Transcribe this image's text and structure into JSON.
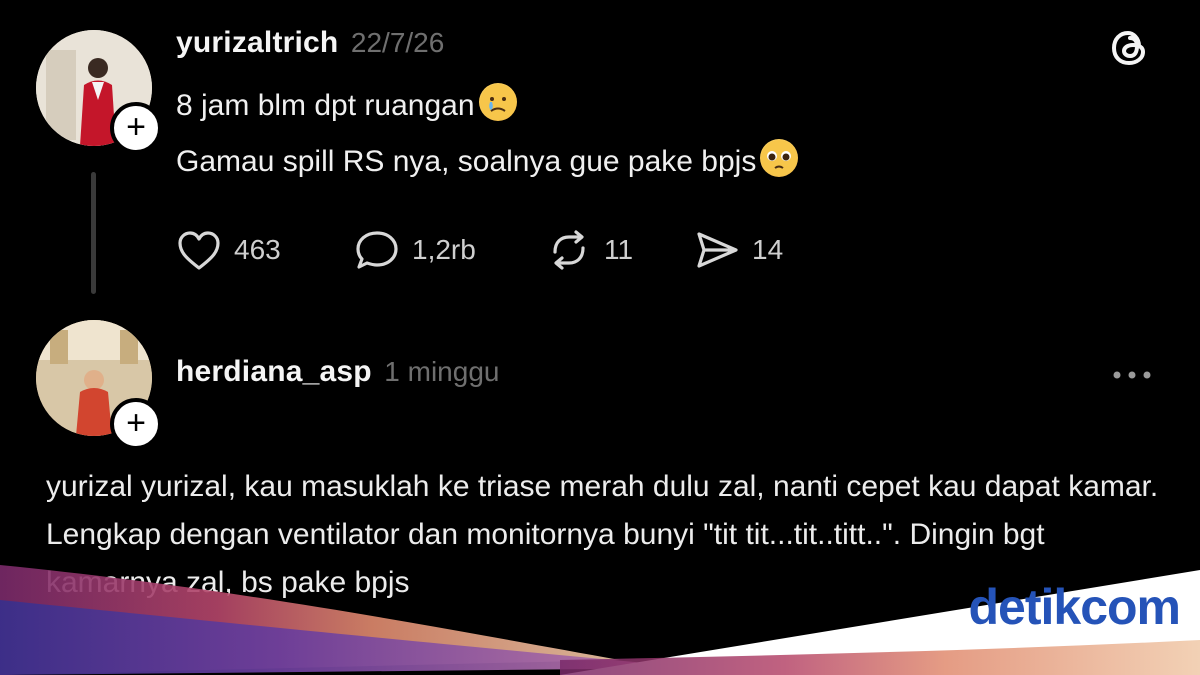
{
  "post": {
    "username": "yurizaltrich",
    "date": "22/7/26",
    "lines": [
      "8 jam blm dpt ruangan",
      "Gamau spill RS nya, soalnya gue pake bpjs"
    ],
    "actions": {
      "likes": "463",
      "replies": "1,2rb",
      "reposts": "11",
      "shares": "14"
    }
  },
  "reply": {
    "username": "herdiana_asp",
    "time": "1 minggu",
    "text": "yurizal yurizal, kau masuklah ke triase merah dulu zal, nanti cepet kau dapat kamar. Lengkap dengan ventilator dan monitornya bunyi \"tit tit...tit..titt..\". Dingin bgt kamarnya zal, bs pake bpjs"
  },
  "app_icon": "threads-icon",
  "watermark": {
    "brand_part1": "detik",
    "brand_part2": "com",
    "color": "#2553b8"
  },
  "colors": {
    "background": "#000000",
    "text": "#f0f0f0",
    "meta": "#6f6f6f"
  }
}
